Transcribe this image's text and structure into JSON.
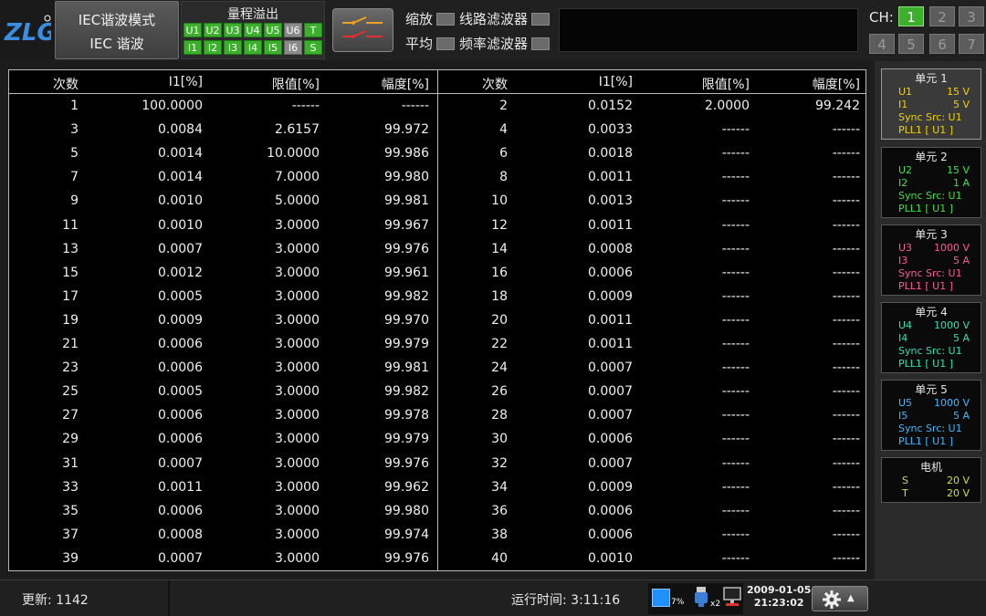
{
  "header": {
    "mode_line1": "IEC谐波模式",
    "mode_line2": "IEC 谐波",
    "overflow_title": "量程溢出",
    "overflow_row1": [
      {
        "label": "U1",
        "on": true
      },
      {
        "label": "U2",
        "on": true
      },
      {
        "label": "U3",
        "on": true
      },
      {
        "label": "U4",
        "on": true
      },
      {
        "label": "U5",
        "on": true
      },
      {
        "label": "U6",
        "on": false
      },
      {
        "label": "T",
        "on": true
      }
    ],
    "overflow_row2": [
      {
        "label": "I1",
        "on": true
      },
      {
        "label": "I2",
        "on": true
      },
      {
        "label": "I3",
        "on": true
      },
      {
        "label": "I4",
        "on": true
      },
      {
        "label": "I5",
        "on": true
      },
      {
        "label": "I6",
        "on": false
      },
      {
        "label": "S",
        "on": true
      }
    ],
    "opt_zoom": "缩放",
    "opt_avg": "平均",
    "opt_line_filter": "线路滤波器",
    "opt_freq_filter": "频率滤波器",
    "ch_label": "CH:",
    "ch_buttons": [
      "1",
      "2",
      "3",
      "4",
      "5",
      "6",
      "7"
    ],
    "ch_active": "1"
  },
  "table": {
    "headers": [
      "次数",
      "I1[%]",
      "限值[%]",
      "幅度[%]"
    ],
    "left": [
      [
        "1",
        "100.0000",
        "------",
        "------"
      ],
      [
        "3",
        "0.0084",
        "2.6157",
        "99.972"
      ],
      [
        "5",
        "0.0014",
        "10.0000",
        "99.986"
      ],
      [
        "7",
        "0.0014",
        "7.0000",
        "99.980"
      ],
      [
        "9",
        "0.0010",
        "5.0000",
        "99.981"
      ],
      [
        "11",
        "0.0010",
        "3.0000",
        "99.967"
      ],
      [
        "13",
        "0.0007",
        "3.0000",
        "99.976"
      ],
      [
        "15",
        "0.0012",
        "3.0000",
        "99.961"
      ],
      [
        "17",
        "0.0005",
        "3.0000",
        "99.982"
      ],
      [
        "19",
        "0.0009",
        "3.0000",
        "99.970"
      ],
      [
        "21",
        "0.0006",
        "3.0000",
        "99.979"
      ],
      [
        "23",
        "0.0006",
        "3.0000",
        "99.981"
      ],
      [
        "25",
        "0.0005",
        "3.0000",
        "99.982"
      ],
      [
        "27",
        "0.0006",
        "3.0000",
        "99.978"
      ],
      [
        "29",
        "0.0006",
        "3.0000",
        "99.979"
      ],
      [
        "31",
        "0.0007",
        "3.0000",
        "99.976"
      ],
      [
        "33",
        "0.0011",
        "3.0000",
        "99.962"
      ],
      [
        "35",
        "0.0006",
        "3.0000",
        "99.980"
      ],
      [
        "37",
        "0.0008",
        "3.0000",
        "99.974"
      ],
      [
        "39",
        "0.0007",
        "3.0000",
        "99.976"
      ]
    ],
    "right": [
      [
        "2",
        "0.0152",
        "2.0000",
        "99.242"
      ],
      [
        "4",
        "0.0033",
        "------",
        "------"
      ],
      [
        "6",
        "0.0018",
        "------",
        "------"
      ],
      [
        "8",
        "0.0011",
        "------",
        "------"
      ],
      [
        "10",
        "0.0013",
        "------",
        "------"
      ],
      [
        "12",
        "0.0011",
        "------",
        "------"
      ],
      [
        "14",
        "0.0008",
        "------",
        "------"
      ],
      [
        "16",
        "0.0006",
        "------",
        "------"
      ],
      [
        "18",
        "0.0009",
        "------",
        "------"
      ],
      [
        "20",
        "0.0011",
        "------",
        "------"
      ],
      [
        "22",
        "0.0011",
        "------",
        "------"
      ],
      [
        "24",
        "0.0007",
        "------",
        "------"
      ],
      [
        "26",
        "0.0007",
        "------",
        "------"
      ],
      [
        "28",
        "0.0007",
        "------",
        "------"
      ],
      [
        "30",
        "0.0006",
        "------",
        "------"
      ],
      [
        "32",
        "0.0007",
        "------",
        "------"
      ],
      [
        "34",
        "0.0009",
        "------",
        "------"
      ],
      [
        "36",
        "0.0006",
        "------",
        "------"
      ],
      [
        "38",
        "0.0006",
        "------",
        "------"
      ],
      [
        "40",
        "0.0010",
        "------",
        "------"
      ]
    ]
  },
  "units": [
    {
      "title": "单元 1",
      "color": "#f0d000",
      "u": "U1",
      "u_range": "15 V",
      "i": "I1",
      "i_range": "5 V",
      "sync": "Sync Src: U1",
      "pll": "PLL1 [ U1 ]",
      "selected": true
    },
    {
      "title": "单元 2",
      "color": "#40e040",
      "u": "U2",
      "u_range": "15 V",
      "i": "I2",
      "i_range": "1 A",
      "sync": "Sync Src: U1",
      "pll": "PLL1 [ U1 ]",
      "selected": false
    },
    {
      "title": "单元 3",
      "color": "#ff5a9a",
      "u": "U3",
      "u_range": "1000 V",
      "i": "I3",
      "i_range": "5 A",
      "sync": "Sync Src: U1",
      "pll": "PLL1 [ U1 ]",
      "selected": false
    },
    {
      "title": "单元 4",
      "color": "#30e0b0",
      "u": "U4",
      "u_range": "1000 V",
      "i": "I4",
      "i_range": "5 A",
      "sync": "Sync Src: U1",
      "pll": "PLL1 [ U1 ]",
      "selected": false
    },
    {
      "title": "单元 5",
      "color": "#40b8ff",
      "u": "U5",
      "u_range": "1000 V",
      "i": "I5",
      "i_range": "5 A",
      "sync": "Sync Src: U1",
      "pll": "PLL1 [ U1 ]",
      "selected": false
    }
  ],
  "motor": {
    "title": "电机",
    "color": "#c8e040",
    "s": "S",
    "s_range": "20 V",
    "t": "T",
    "t_range": "20 V"
  },
  "status": {
    "update": "更新: 1142",
    "runtime": "运行时间: 3:11:16",
    "storage_pct": "7%",
    "usb_count": "x2",
    "date": "2009-01-05",
    "time": "21:23:02"
  },
  "colors": {
    "on": "#3cb02c",
    "off": "#8a8a8a"
  }
}
